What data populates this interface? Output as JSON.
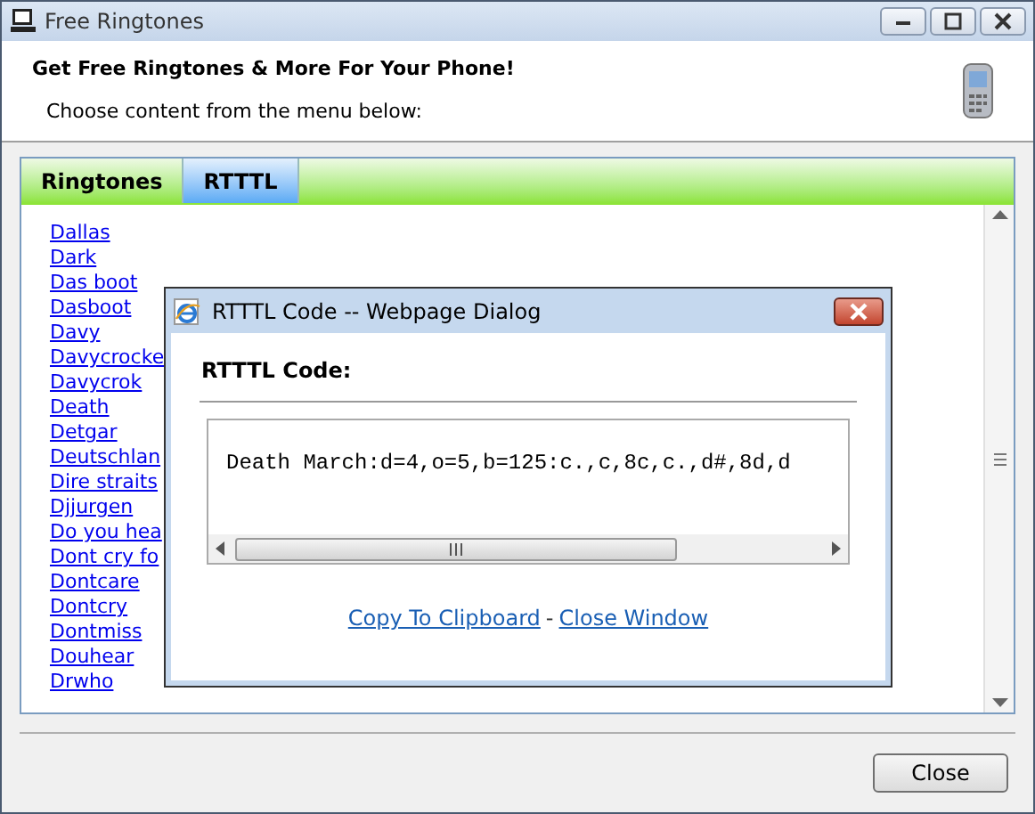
{
  "window": {
    "title": "Free Ringtones"
  },
  "header": {
    "title": "Get Free Ringtones & More For Your Phone!",
    "subtitle": "Choose content from the menu below:"
  },
  "tabs": [
    {
      "label": "Ringtones",
      "selected": false
    },
    {
      "label": "RTTTL",
      "selected": true
    }
  ],
  "ringtones": [
    "Dallas",
    "Dark",
    "Das boot",
    "Dasboot",
    "Davy",
    "Davycrocke",
    "Davycrok",
    "Death",
    "Detgar",
    "Deutschlan",
    "Dire straits",
    "Djjurgen",
    "Do you hea",
    "Dont cry fo",
    "Dontcare",
    "Dontcry",
    "Dontmiss",
    "Douhear",
    "Drwho"
  ],
  "dialog": {
    "title": "RTTTL Code -- Webpage Dialog",
    "heading": "RTTTL Code:",
    "code": "Death March:d=4,o=5,b=125:c.,c,8c,c.,d#,8d,d",
    "links": [
      {
        "label": "Copy To Clipboard"
      },
      {
        "label": "Close Window"
      }
    ],
    "separator": "-"
  },
  "buttons": [
    {
      "label": "Close"
    }
  ]
}
